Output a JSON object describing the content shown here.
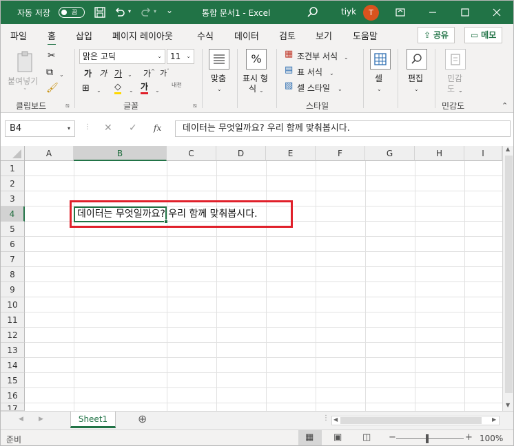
{
  "titlebar": {
    "autosave_label": "자동 저장",
    "autosave_state": "끔",
    "doc_title": "통합 문서1  -  Excel",
    "user_name": "tiyk",
    "avatar_initial": "T"
  },
  "tabs": [
    "파일",
    "홈",
    "삽입",
    "페이지 레이아웃",
    "수식",
    "데이터",
    "검토",
    "보기",
    "도움말"
  ],
  "active_tab": "홈",
  "share_label": "공유",
  "comments_label": "메모",
  "ribbon": {
    "clipboard": {
      "paste_label": "붙여넣기",
      "group_label": "클립보드"
    },
    "font": {
      "font_name": "맑은 고딕",
      "font_size": "11",
      "group_label": "글꼴",
      "bold": "가",
      "italic": "가",
      "underline": "가",
      "grow": "가",
      "shrink": "가",
      "color_glyph": "가",
      "phonetic": "내천"
    },
    "alignment": {
      "label": "맞춤"
    },
    "number": {
      "label_line1": "표시 형",
      "label_line2": "식",
      "icon_glyph": "%"
    },
    "styles": {
      "conditional": "조건부 서식",
      "table": "표 서식",
      "cell_styles": "셀 스타일",
      "group_label": "스타일"
    },
    "cells": {
      "label": "셀"
    },
    "editing": {
      "label": "편집"
    },
    "sensitivity": {
      "label_line1": "민감",
      "label_line2": "도",
      "group_label": "민감도"
    }
  },
  "namebox": "B4",
  "formula_text": "데이터는 무엇일까요? 우리 함께 맞춰봅시다.",
  "grid": {
    "columns": [
      "A",
      "B",
      "C",
      "D",
      "E",
      "F",
      "G",
      "H",
      "I"
    ],
    "rows": [
      "1",
      "2",
      "3",
      "4",
      "5",
      "6",
      "7",
      "8",
      "9",
      "10",
      "11",
      "12",
      "13",
      "14",
      "15",
      "16",
      "17"
    ],
    "selected_column": "B",
    "selected_row": "4",
    "cell_B4_text": "데이터는 무엇일까요? 우리 함께 맞춰봅시다."
  },
  "sheet_tab": "Sheet1",
  "status": {
    "mode": "준비",
    "zoom": "100%"
  },
  "colors": {
    "excel_green": "#217346",
    "highlight_red": "#e0202a"
  }
}
